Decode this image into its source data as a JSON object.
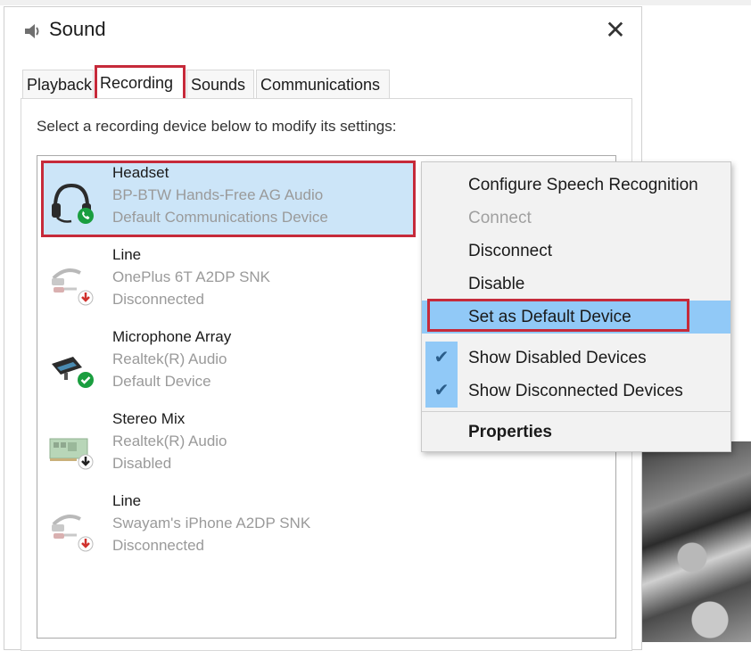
{
  "window": {
    "title": "Sound",
    "close_glyph": "✕",
    "icon": "speaker-icon"
  },
  "tabs": [
    {
      "label": "Playback",
      "active": false
    },
    {
      "label": "Recording",
      "active": true
    },
    {
      "label": "Sounds",
      "active": false
    },
    {
      "label": "Communications",
      "active": false
    }
  ],
  "instructions": "Select a recording device below to modify its settings:",
  "devices": [
    {
      "name": "Headset",
      "description": "BP-BTW Hands-Free AG Audio",
      "status": "Default Communications Device",
      "icon": "headset-icon",
      "badge": "phone-badge-icon",
      "selected": true
    },
    {
      "name": "Line",
      "description": "OnePlus 6T A2DP SNK",
      "status": "Disconnected",
      "icon": "line-in-icon",
      "badge": "disconnected-badge-icon",
      "selected": false
    },
    {
      "name": "Microphone Array",
      "description": "Realtek(R) Audio",
      "status": "Default Device",
      "icon": "microphone-icon",
      "badge": "default-check-badge-icon",
      "selected": false
    },
    {
      "name": "Stereo Mix",
      "description": "Realtek(R) Audio",
      "status": "Disabled",
      "icon": "soundcard-icon",
      "badge": "disabled-badge-icon",
      "selected": false
    },
    {
      "name": "Line",
      "description": "Swayam's iPhone A2DP SNK",
      "status": "Disconnected",
      "icon": "line-in-icon",
      "badge": "disconnected-badge-icon",
      "selected": false
    }
  ],
  "context_menu": {
    "items": [
      {
        "label": "Configure Speech Recognition",
        "disabled": false
      },
      {
        "label": "Connect",
        "disabled": true
      },
      {
        "label": "Disconnect",
        "disabled": false
      },
      {
        "label": "Disable",
        "disabled": false
      },
      {
        "label": "Set as Default Device",
        "hovered": true
      },
      {
        "label": "Show Disabled Devices",
        "checked": true
      },
      {
        "label": "Show Disconnected Devices",
        "checked": true
      },
      {
        "label": "Properties",
        "bold": true
      }
    ],
    "check_glyph": "✔"
  },
  "colors": {
    "highlight_outline": "#c62a3a",
    "selection_bg": "#cce5f8",
    "menu_hover": "#91c9f7",
    "status_green": "#1a9e3f",
    "status_red": "#d0312d"
  }
}
